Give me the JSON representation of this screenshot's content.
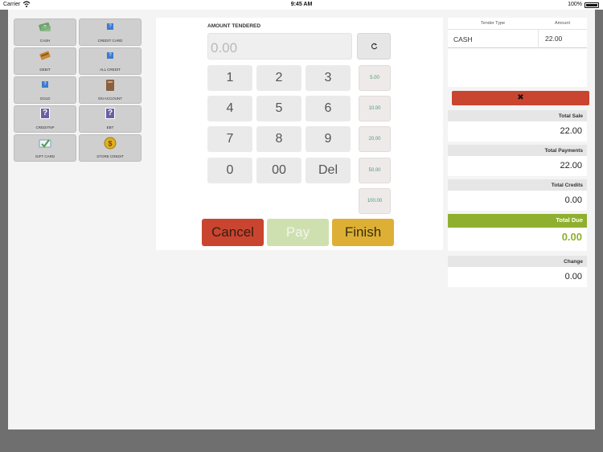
{
  "status_bar": {
    "carrier": "Carrier",
    "time": "9:45 AM",
    "battery": "100%"
  },
  "tenders": [
    {
      "label": "CASH",
      "icon": "cash-icon"
    },
    {
      "label": "CREDIT CARD",
      "icon": "question-icon"
    },
    {
      "label": "DEBIT",
      "icon": "debit-card-icon"
    },
    {
      "label": "ALL CREDIT",
      "icon": "question-icon"
    },
    {
      "label": "GOLD",
      "icon": "question-icon"
    },
    {
      "label": "ON ACCOUNT",
      "icon": "ledger-icon"
    },
    {
      "label": "CREDITNP",
      "icon": "question-icon"
    },
    {
      "label": "EBT",
      "icon": "question-icon"
    },
    {
      "label": "GIFT CARD",
      "icon": "gift-card-icon"
    },
    {
      "label": "STORE CREDIT",
      "icon": "coin-icon"
    }
  ],
  "keypad": {
    "amount_label": "AMOUNT TENDERED",
    "amount_placeholder": "0.00",
    "keys": [
      "1",
      "2",
      "3",
      "4",
      "5",
      "6",
      "7",
      "8",
      "9",
      "0",
      "00",
      "Del"
    ],
    "quick_amounts": [
      "5.00",
      "10.00",
      "20.00",
      "50.00",
      "100.00"
    ],
    "cancel_label": "Cancel",
    "pay_label": "Pay",
    "finish_label": "Finish"
  },
  "tender_table": {
    "col_type": "Tender Type",
    "col_amount": "Amount",
    "rows": [
      {
        "type": "CASH",
        "amount": "22.00"
      }
    ]
  },
  "summary": {
    "total_sale_label": "Total Sale",
    "total_sale": "22.00",
    "total_payments_label": "Total Payments",
    "total_payments": "22.00",
    "total_credits_label": "Total Credits",
    "total_credits": "0.00",
    "total_due_label": "Total Due",
    "total_due": "0.00",
    "change_label": "Change",
    "change": "0.00"
  },
  "colors": {
    "accent_green": "#8eb02e",
    "danger": "#c9452f",
    "finish": "#ddb035",
    "pay_disabled": "#cfe0b0"
  }
}
